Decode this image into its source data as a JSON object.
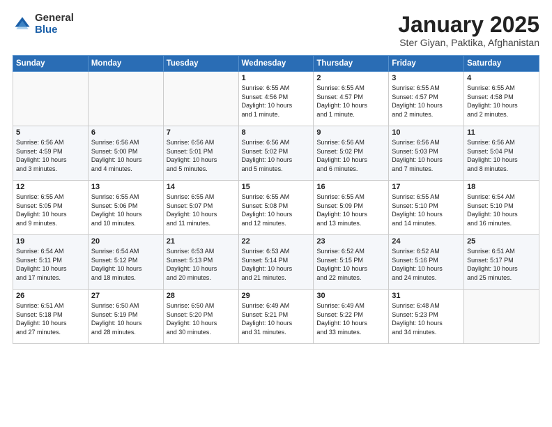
{
  "logo": {
    "general": "General",
    "blue": "Blue"
  },
  "title": "January 2025",
  "subtitle": "Ster Giyan, Paktika, Afghanistan",
  "weekdays": [
    "Sunday",
    "Monday",
    "Tuesday",
    "Wednesday",
    "Thursday",
    "Friday",
    "Saturday"
  ],
  "weeks": [
    [
      {
        "day": "",
        "info": ""
      },
      {
        "day": "",
        "info": ""
      },
      {
        "day": "",
        "info": ""
      },
      {
        "day": "1",
        "info": "Sunrise: 6:55 AM\nSunset: 4:56 PM\nDaylight: 10 hours\nand 1 minute."
      },
      {
        "day": "2",
        "info": "Sunrise: 6:55 AM\nSunset: 4:57 PM\nDaylight: 10 hours\nand 1 minute."
      },
      {
        "day": "3",
        "info": "Sunrise: 6:55 AM\nSunset: 4:57 PM\nDaylight: 10 hours\nand 2 minutes."
      },
      {
        "day": "4",
        "info": "Sunrise: 6:55 AM\nSunset: 4:58 PM\nDaylight: 10 hours\nand 2 minutes."
      }
    ],
    [
      {
        "day": "5",
        "info": "Sunrise: 6:56 AM\nSunset: 4:59 PM\nDaylight: 10 hours\nand 3 minutes."
      },
      {
        "day": "6",
        "info": "Sunrise: 6:56 AM\nSunset: 5:00 PM\nDaylight: 10 hours\nand 4 minutes."
      },
      {
        "day": "7",
        "info": "Sunrise: 6:56 AM\nSunset: 5:01 PM\nDaylight: 10 hours\nand 5 minutes."
      },
      {
        "day": "8",
        "info": "Sunrise: 6:56 AM\nSunset: 5:02 PM\nDaylight: 10 hours\nand 5 minutes."
      },
      {
        "day": "9",
        "info": "Sunrise: 6:56 AM\nSunset: 5:02 PM\nDaylight: 10 hours\nand 6 minutes."
      },
      {
        "day": "10",
        "info": "Sunrise: 6:56 AM\nSunset: 5:03 PM\nDaylight: 10 hours\nand 7 minutes."
      },
      {
        "day": "11",
        "info": "Sunrise: 6:56 AM\nSunset: 5:04 PM\nDaylight: 10 hours\nand 8 minutes."
      }
    ],
    [
      {
        "day": "12",
        "info": "Sunrise: 6:55 AM\nSunset: 5:05 PM\nDaylight: 10 hours\nand 9 minutes."
      },
      {
        "day": "13",
        "info": "Sunrise: 6:55 AM\nSunset: 5:06 PM\nDaylight: 10 hours\nand 10 minutes."
      },
      {
        "day": "14",
        "info": "Sunrise: 6:55 AM\nSunset: 5:07 PM\nDaylight: 10 hours\nand 11 minutes."
      },
      {
        "day": "15",
        "info": "Sunrise: 6:55 AM\nSunset: 5:08 PM\nDaylight: 10 hours\nand 12 minutes."
      },
      {
        "day": "16",
        "info": "Sunrise: 6:55 AM\nSunset: 5:09 PM\nDaylight: 10 hours\nand 13 minutes."
      },
      {
        "day": "17",
        "info": "Sunrise: 6:55 AM\nSunset: 5:10 PM\nDaylight: 10 hours\nand 14 minutes."
      },
      {
        "day": "18",
        "info": "Sunrise: 6:54 AM\nSunset: 5:10 PM\nDaylight: 10 hours\nand 16 minutes."
      }
    ],
    [
      {
        "day": "19",
        "info": "Sunrise: 6:54 AM\nSunset: 5:11 PM\nDaylight: 10 hours\nand 17 minutes."
      },
      {
        "day": "20",
        "info": "Sunrise: 6:54 AM\nSunset: 5:12 PM\nDaylight: 10 hours\nand 18 minutes."
      },
      {
        "day": "21",
        "info": "Sunrise: 6:53 AM\nSunset: 5:13 PM\nDaylight: 10 hours\nand 20 minutes."
      },
      {
        "day": "22",
        "info": "Sunrise: 6:53 AM\nSunset: 5:14 PM\nDaylight: 10 hours\nand 21 minutes."
      },
      {
        "day": "23",
        "info": "Sunrise: 6:52 AM\nSunset: 5:15 PM\nDaylight: 10 hours\nand 22 minutes."
      },
      {
        "day": "24",
        "info": "Sunrise: 6:52 AM\nSunset: 5:16 PM\nDaylight: 10 hours\nand 24 minutes."
      },
      {
        "day": "25",
        "info": "Sunrise: 6:51 AM\nSunset: 5:17 PM\nDaylight: 10 hours\nand 25 minutes."
      }
    ],
    [
      {
        "day": "26",
        "info": "Sunrise: 6:51 AM\nSunset: 5:18 PM\nDaylight: 10 hours\nand 27 minutes."
      },
      {
        "day": "27",
        "info": "Sunrise: 6:50 AM\nSunset: 5:19 PM\nDaylight: 10 hours\nand 28 minutes."
      },
      {
        "day": "28",
        "info": "Sunrise: 6:50 AM\nSunset: 5:20 PM\nDaylight: 10 hours\nand 30 minutes."
      },
      {
        "day": "29",
        "info": "Sunrise: 6:49 AM\nSunset: 5:21 PM\nDaylight: 10 hours\nand 31 minutes."
      },
      {
        "day": "30",
        "info": "Sunrise: 6:49 AM\nSunset: 5:22 PM\nDaylight: 10 hours\nand 33 minutes."
      },
      {
        "day": "31",
        "info": "Sunrise: 6:48 AM\nSunset: 5:23 PM\nDaylight: 10 hours\nand 34 minutes."
      },
      {
        "day": "",
        "info": ""
      }
    ]
  ]
}
